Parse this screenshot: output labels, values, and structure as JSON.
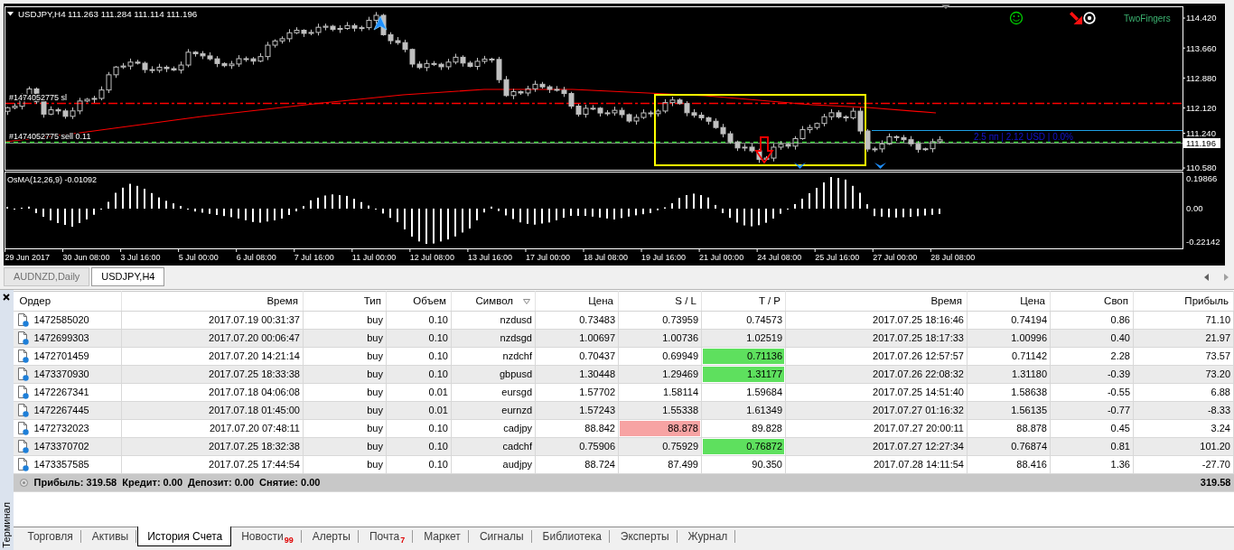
{
  "chart": {
    "symbol": "USDJPY,H4",
    "quotes": "111.263 111.284 111.114 111.196",
    "expert": "TwoFingers",
    "price_axis": [
      "114.420",
      "113.660",
      "112.880",
      "112.120",
      "111.240",
      "110.580"
    ],
    "current_price": "111.196",
    "order_lines": [
      {
        "kind": "stop_loss",
        "label": "#1474052775 sl"
      },
      {
        "kind": "order",
        "label": "#1474052775 sell 0.11"
      }
    ],
    "info": "2.5 пп | 2.12 USD | 0.0%",
    "indicator": {
      "label": "OsMA(12,26,9) -0.01092",
      "axis": [
        "0.19866",
        "0.00",
        "-0.22142"
      ]
    },
    "time_axis": [
      "29 Jun 2017",
      "30 Jun 08:00",
      "3 Jul 16:00",
      "5 Jul 00:00",
      "6 Jul 08:00",
      "7 Jul 16:00",
      "11 Jul 00:00",
      "12 Jul 08:00",
      "13 Jul 16:00",
      "17 Jul 00:00",
      "18 Jul 08:00",
      "19 Jul 16:00",
      "21 Jul 00:00",
      "24 Jul 08:00",
      "25 Jul 16:00",
      "27 Jul 00:00",
      "28 Jul 08:00"
    ]
  },
  "chart_tabs": [
    {
      "label": "AUDNZD,Daily",
      "selected": false
    },
    {
      "label": "USDJPY,H4",
      "selected": true
    }
  ],
  "terminal": {
    "title": "Терминал",
    "columns": [
      {
        "label": "Ордер",
        "sorted": false
      },
      {
        "label": "Время",
        "sorted": false
      },
      {
        "label": "Тип",
        "sorted": false
      },
      {
        "label": "Объем",
        "sorted": false
      },
      {
        "label": "Символ",
        "sorted": true
      },
      {
        "label": "Цена",
        "sorted": false
      },
      {
        "label": "S / L",
        "sorted": false
      },
      {
        "label": "T / P",
        "sorted": false
      },
      {
        "label": "Время",
        "sorted": false
      },
      {
        "label": "Цена",
        "sorted": false
      },
      {
        "label": "Своп",
        "sorted": false
      },
      {
        "label": "Прибыль",
        "sorted": false
      }
    ],
    "rows": [
      {
        "cells": [
          "1472585020",
          "2017.07.19 00:31:37",
          "buy",
          "0.10",
          "nzdusd",
          "0.73483",
          "0.73959",
          "0.74573",
          "2017.07.25 18:16:46",
          "0.74194",
          "0.86",
          "71.10"
        ],
        "sl_hit": false,
        "tp_hit": false
      },
      {
        "cells": [
          "1472699303",
          "2017.07.20 00:06:47",
          "buy",
          "0.10",
          "nzdsgd",
          "1.00697",
          "1.00736",
          "1.02519",
          "2017.07.25 18:17:33",
          "1.00996",
          "0.40",
          "21.97"
        ],
        "sl_hit": false,
        "tp_hit": false
      },
      {
        "cells": [
          "1472701459",
          "2017.07.20 14:21:14",
          "buy",
          "0.10",
          "nzdchf",
          "0.70437",
          "0.69949",
          "0.71136",
          "2017.07.26 12:57:57",
          "0.71142",
          "2.28",
          "73.57"
        ],
        "sl_hit": false,
        "tp_hit": true
      },
      {
        "cells": [
          "1473370930",
          "2017.07.25 18:33:38",
          "buy",
          "0.10",
          "gbpusd",
          "1.30448",
          "1.29469",
          "1.31177",
          "2017.07.26 22:08:32",
          "1.31180",
          "-0.39",
          "73.20"
        ],
        "sl_hit": false,
        "tp_hit": true
      },
      {
        "cells": [
          "1472267341",
          "2017.07.18 04:06:08",
          "buy",
          "0.01",
          "eursgd",
          "1.57702",
          "1.58114",
          "1.59684",
          "2017.07.25 14:51:40",
          "1.58638",
          "-0.55",
          "6.88"
        ],
        "sl_hit": false,
        "tp_hit": false
      },
      {
        "cells": [
          "1472267445",
          "2017.07.18 01:45:00",
          "buy",
          "0.01",
          "eurnzd",
          "1.57243",
          "1.55338",
          "1.61349",
          "2017.07.27 01:16:32",
          "1.56135",
          "-0.77",
          "-8.33"
        ],
        "sl_hit": false,
        "tp_hit": false
      },
      {
        "cells": [
          "1472732023",
          "2017.07.20 07:48:11",
          "buy",
          "0.10",
          "cadjpy",
          "88.842",
          "88.878",
          "89.828",
          "2017.07.27 20:00:11",
          "88.878",
          "0.45",
          "3.24"
        ],
        "sl_hit": true,
        "tp_hit": false
      },
      {
        "cells": [
          "1473370702",
          "2017.07.25 18:32:38",
          "buy",
          "0.10",
          "cadchf",
          "0.75906",
          "0.75929",
          "0.76872",
          "2017.07.27 12:27:34",
          "0.76874",
          "0.81",
          "101.20"
        ],
        "sl_hit": false,
        "tp_hit": true
      },
      {
        "cells": [
          "1473357585",
          "2017.07.25 17:44:54",
          "buy",
          "0.10",
          "audjpy",
          "88.724",
          "87.499",
          "90.350",
          "2017.07.28 14:11:54",
          "88.416",
          "1.36",
          "-27.70"
        ],
        "sl_hit": false,
        "tp_hit": false
      }
    ],
    "summary": {
      "items": [
        "Прибыль: 319.58",
        "Кредит: 0.00",
        "Депозит: 0.00",
        "Снятие: 0.00"
      ],
      "total": "319.58"
    },
    "tabs": [
      {
        "label": "Торговля",
        "selected": false
      },
      {
        "label": "Активы",
        "selected": false
      },
      {
        "label": "История Счета",
        "selected": true
      },
      {
        "label": "Новости",
        "badge": "99",
        "selected": false
      },
      {
        "label": "Алерты",
        "selected": false
      },
      {
        "label": "Почта",
        "badge": "7",
        "selected": false
      },
      {
        "label": "Маркет",
        "selected": false
      },
      {
        "label": "Сигналы",
        "selected": false
      },
      {
        "label": "Библиотека",
        "selected": false
      },
      {
        "label": "Эксперты",
        "selected": false
      },
      {
        "label": "Журнал",
        "selected": false
      }
    ]
  }
}
